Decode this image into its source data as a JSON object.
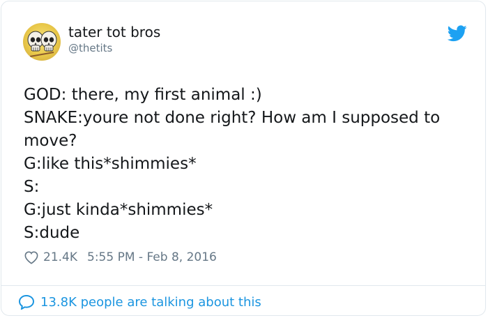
{
  "author": {
    "display_name": "tater tot bros",
    "handle": "@thetits",
    "avatar_icon": "two-skulls-avatar"
  },
  "tweet": {
    "lines": [
      "GOD: there, my first animal :)",
      "SNAKE:youre not done right? How am I supposed to",
      "move?",
      "G:like this*shimmies*",
      "S:",
      "G:just kinda*shimmies*",
      "S:dude"
    ]
  },
  "meta": {
    "likes": "21.4K",
    "timestamp": "5:55 PM - Feb 8, 2016"
  },
  "footer": {
    "conversation": "13.8K people are talking about this"
  },
  "colors": {
    "accent": "#1b95e0",
    "muted": "#657786",
    "text": "#14171a",
    "border": "#e1e8ed"
  }
}
